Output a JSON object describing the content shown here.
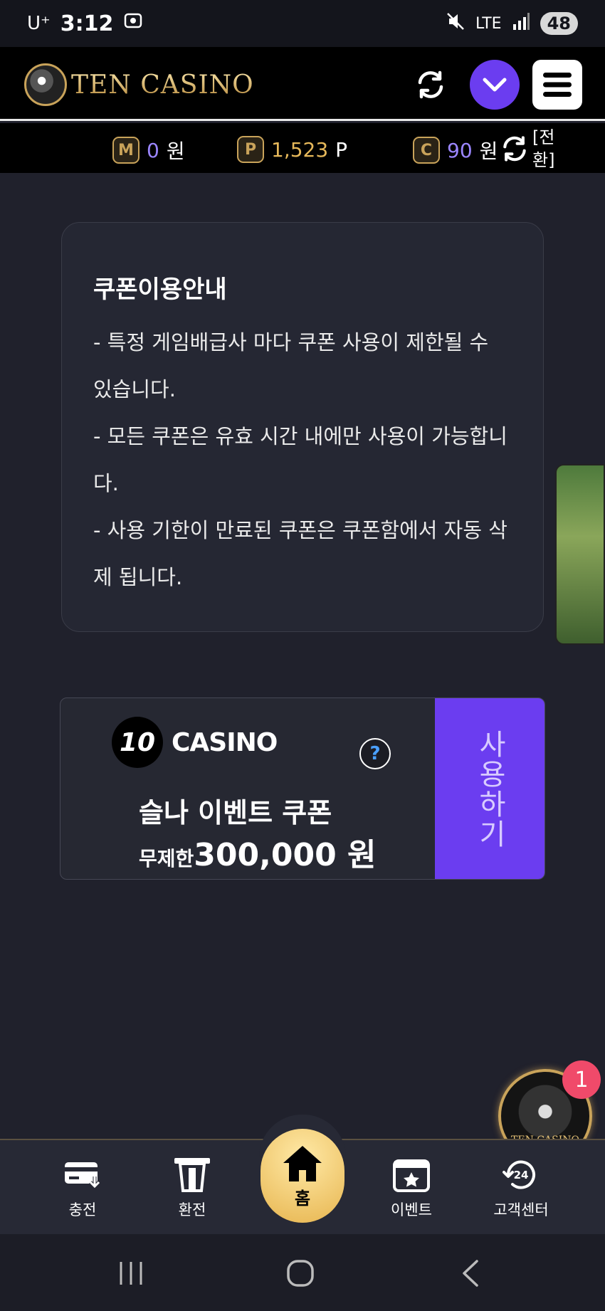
{
  "status_bar": {
    "carrier": "U⁺",
    "time": "3:12",
    "network": "LTE",
    "battery": "48"
  },
  "header": {
    "logo_text": "TEN CASINO"
  },
  "balances": {
    "money": {
      "badge": "M",
      "value": "0",
      "unit": "원"
    },
    "points": {
      "badge": "P",
      "value": "1,523",
      "unit": "P"
    },
    "coupon": {
      "badge": "C",
      "value": "90",
      "unit": "원"
    },
    "exchange_label": "[전환]"
  },
  "notice": {
    "title": "쿠폰이용안내",
    "lines": [
      "- 특정 게임배급사 마다 쿠폰 사용이 제한될 수 있습니다.",
      "- 모든 쿠폰은 유효 시간 내에만 사용이 가능합니다.",
      "- 사용 기한이 만료된 쿠폰은 쿠폰함에서 자동 삭제 됩니다."
    ]
  },
  "coupon": {
    "brand_mark": "10",
    "brand_text": "CASINO",
    "help": "?",
    "name": "슬나 이벤트 쿠폰",
    "limit_label": "무제한",
    "amount": "300,000 원",
    "use_button": "사용하기"
  },
  "floating": {
    "logo_text": "TEN CASINO",
    "badge_count": "1"
  },
  "bottom_nav": {
    "charge": "충전",
    "withdraw": "환전",
    "home": "홈",
    "event": "이벤트",
    "support": "고객센터"
  },
  "colors": {
    "background": "#20212c",
    "accent_purple": "#6b3df0",
    "gold": "#c9a35a"
  }
}
